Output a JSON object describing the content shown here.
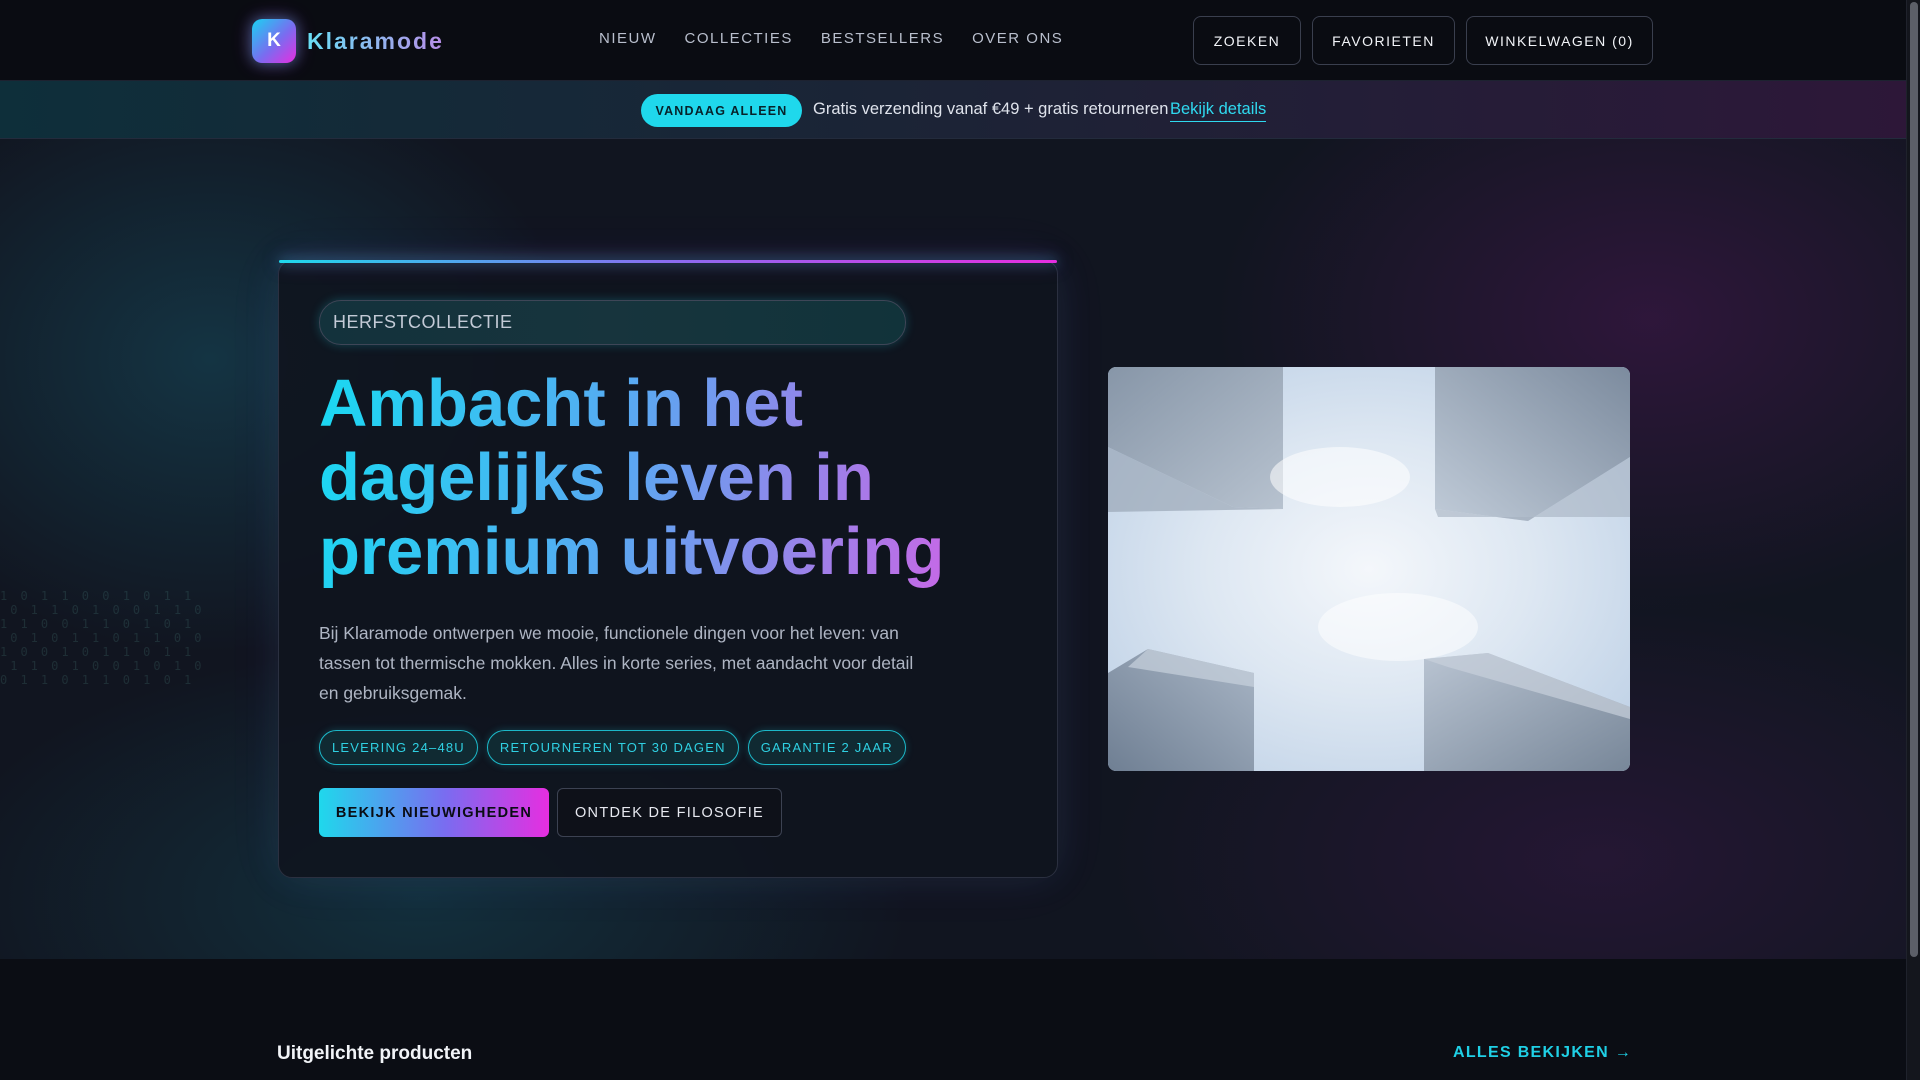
{
  "brand": {
    "initial": "K",
    "name": "Klaramode"
  },
  "nav": [
    {
      "label": "NIEUW"
    },
    {
      "label": "COLLECTIES"
    },
    {
      "label": "BESTSELLERS"
    },
    {
      "label": "OVER ONS"
    }
  ],
  "header_actions": {
    "search": "ZOEKEN",
    "favorites": "FAVORIETEN",
    "cart": "WINKELWAGEN (0)"
  },
  "promo": {
    "badge": "VANDAAG ALLEEN",
    "text": "Gratis verzending vanaf €49 + gratis retourneren",
    "link": "Bekijk details"
  },
  "hero": {
    "collection_value": "HERFSTCOLLECTIE",
    "headline": "Ambacht in het dagelijks leven in premium uitvoering",
    "lead": "Bij Klaramode ontwerpen we mooie, functionele dingen voor het leven: van tassen tot thermische mokken. Alles in korte series, met aandacht voor detail en gebruiksgemak.",
    "chips": [
      {
        "label": "LEVERING 24–48U"
      },
      {
        "label": "RETOURNEREN TOT 30 DAGEN"
      },
      {
        "label": "GARANTIE 2 JAAR"
      }
    ],
    "primary_cta": "BEKIJK NIEUWIGHEDEN",
    "secondary_cta": "ONTDEK DE FILOSOFIE"
  },
  "featured": {
    "title": "Uitgelichte producten",
    "view_all": "ALLES BEKIJKEN →"
  },
  "colors": {
    "accent_cyan": "#1fd8ec",
    "accent_magenta": "#e62ee0",
    "accent_violet": "#7a6cf0",
    "background": "#0b0d14"
  }
}
